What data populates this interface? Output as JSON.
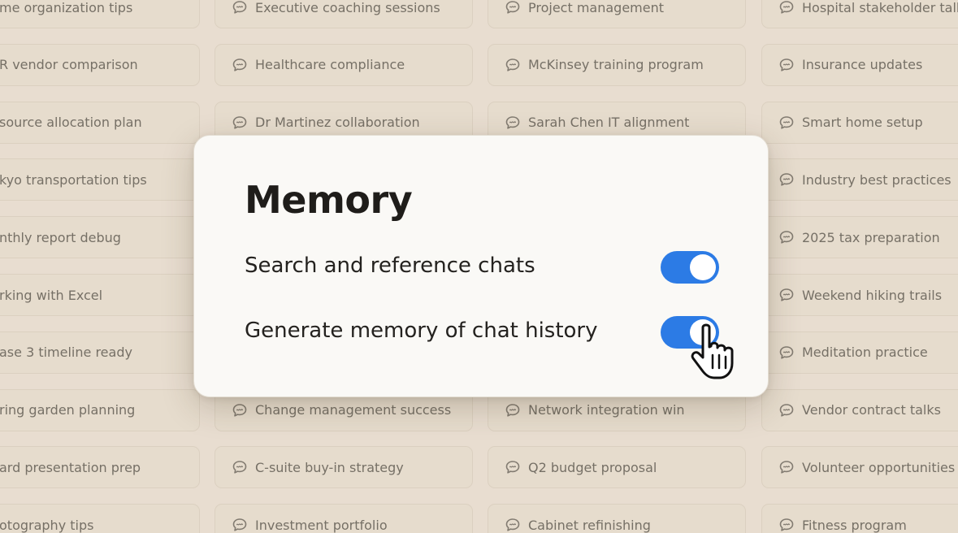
{
  "background_chips": [
    [
      "me organization tips",
      "Executive coaching sessions",
      "Project management",
      "Hospital stakeholder talk"
    ],
    [
      "R vendor comparison",
      "Healthcare compliance",
      "McKinsey training program",
      "Insurance updates"
    ],
    [
      "source allocation plan",
      "Dr Martinez collaboration",
      "Sarah Chen IT alignment",
      "Smart home setup"
    ],
    [
      "kyo transportation tips",
      "",
      "",
      "Industry best practices"
    ],
    [
      "nthly report debug",
      "",
      "",
      "2025 tax preparation"
    ],
    [
      "rking with Excel",
      "",
      "",
      "Weekend hiking trails"
    ],
    [
      "ase 3 timeline ready",
      "",
      "",
      "Meditation practice"
    ],
    [
      "ring garden planning",
      "Change management success",
      "Network integration win",
      "Vendor contract talks"
    ],
    [
      "ard presentation prep",
      "C-suite buy-in strategy",
      "Q2 budget proposal",
      "Volunteer opportunities"
    ],
    [
      "otography tips",
      "Investment portfolio",
      "Cabinet refinishing",
      "Fitness program"
    ]
  ],
  "memory": {
    "title": "Memory",
    "settings": [
      {
        "label": "Search and reference chats",
        "enabled": true
      },
      {
        "label": "Generate memory of chat history",
        "enabled": true
      }
    ]
  },
  "colors": {
    "toggle_on": "#2c7be5",
    "background": "#e8ddd0",
    "card": "#faf9f6"
  },
  "icons": {
    "chip": "chat-bubble-icon",
    "cursor": "hand-pointer-icon"
  }
}
